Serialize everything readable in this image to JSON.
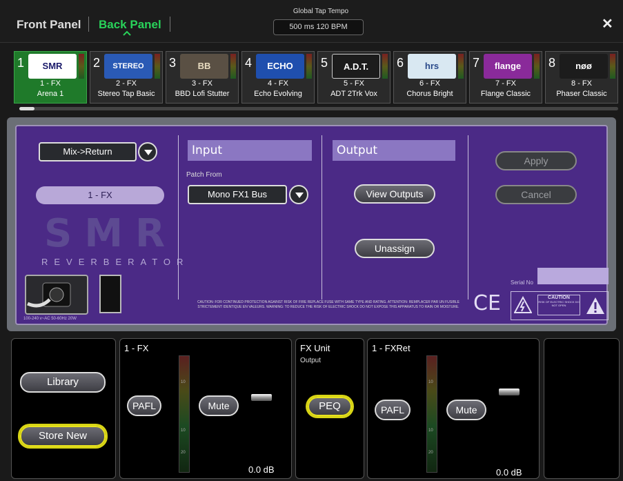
{
  "topbar": {
    "front_panel": "Front Panel",
    "back_panel": "Back Panel",
    "tap_title": "Global Tap Tempo",
    "tap_value": "500 ms   120 BPM",
    "close": "✕"
  },
  "slots": [
    {
      "num": "1",
      "logo": "SMR",
      "l1": "1 - FX",
      "l2": "Arena 1",
      "active": true,
      "logo_bg": "#ffffff",
      "logo_fg": "#1a1a6a"
    },
    {
      "num": "2",
      "logo": "STEREO",
      "l1": "2 - FX",
      "l2": "Stereo Tap Basic",
      "logo_bg": "#2a5ab5",
      "logo_fg": "#ffffff"
    },
    {
      "num": "3",
      "logo": "BB",
      "l1": "3 - FX",
      "l2": "BBD Lofi Stutter",
      "logo_bg": "#5a5044",
      "logo_fg": "#e8dcc0"
    },
    {
      "num": "4",
      "logo": "ECHO",
      "l1": "4 - FX",
      "l2": "Echo Evolving",
      "logo_bg": "#1f4fae",
      "logo_fg": "#ffffff"
    },
    {
      "num": "5",
      "logo": "A.D.T.",
      "l1": "5 - FX",
      "l2": "ADT 2Trk Vox",
      "logo_bg": "#1c1c1c",
      "logo_fg": "#ffffff"
    },
    {
      "num": "6",
      "logo": "hrs",
      "l1": "6 - FX",
      "l2": "Chorus Bright",
      "logo_bg": "#d9e8f2",
      "logo_fg": "#2a4a8a"
    },
    {
      "num": "7",
      "logo": "flange",
      "l1": "7 - FX",
      "l2": "Flange Classic",
      "logo_bg": "#8a2a9a",
      "logo_fg": "#ffffff"
    },
    {
      "num": "8",
      "logo": "nøø",
      "l1": "8 - FX",
      "l2": "Phaser Classic",
      "logo_bg": "#1c1c1c",
      "logo_fg": "#ffffff"
    }
  ],
  "panel": {
    "mode_select": "Mix->Return",
    "fx_name": "1 - FX",
    "brand": "SMR",
    "brand_sub": "REVERBERATOR",
    "power_spec": "100-240 v~AC   50-60Hz   20W",
    "input_header": "Input",
    "patch_from_label": "Patch From",
    "patch_from_value": "Mono FX1 Bus",
    "output_header": "Output",
    "view_outputs": "View Outputs",
    "unassign": "Unassign",
    "apply": "Apply",
    "cancel": "Cancel",
    "serial_label": "Serial No",
    "ce": "CE",
    "caution_text": "CAUTION:  FOR CONTINUED PROTECTION AGAINST RISK OF FIRE REPLACE FUSE WITH SAME TYPE AND RATING. ATTENTION: REMPLACER PAR UN FUSIBLE STRICTEMENT IDENTIQUE EN VALEURS. WARNING: TO REDUCE THE RISK OF ELECTRIC SHOCK DO NOT EXPOSE THIS APPARATUS TO RAIN OR MOISTURE.",
    "warn_label": "CAUTION",
    "warn_sub": "RISK OF ELECTRIC SHOCK DO NOT OPEN"
  },
  "bottom": {
    "library": "Library",
    "store_new": "Store New",
    "ch1": {
      "title": "1 - FX",
      "pafl": "PAFL",
      "mute": "Mute",
      "level": "0.0 dB",
      "tick_top": "10",
      "tick_mid": "10",
      "tick_low": "20"
    },
    "fxunit": {
      "title": "FX Unit",
      "sub": "Output",
      "peq": "PEQ"
    },
    "ch2": {
      "title": "1 - FXRet",
      "pafl": "PAFL",
      "mute": "Mute",
      "level": "0.0 dB",
      "tick_top": "10",
      "tick_mid": "10",
      "tick_low": "20"
    }
  }
}
